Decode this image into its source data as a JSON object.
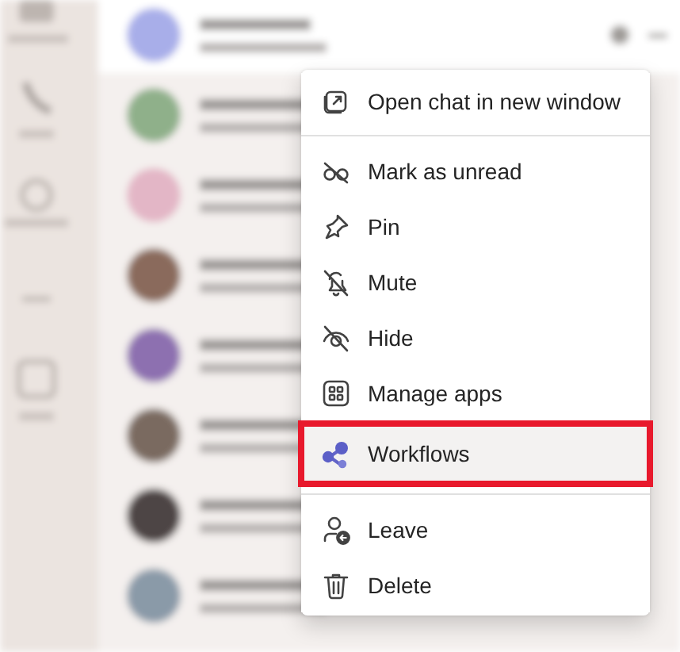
{
  "context_menu": {
    "groups": [
      {
        "items": [
          {
            "label": "Open chat in new window",
            "kind": "popout",
            "highlighted": false
          }
        ]
      },
      {
        "items": [
          {
            "label": "Mark as unread",
            "kind": "unread",
            "highlighted": false
          },
          {
            "label": "Pin",
            "kind": "pin",
            "highlighted": false
          },
          {
            "label": "Mute",
            "kind": "mute",
            "highlighted": false
          },
          {
            "label": "Hide",
            "kind": "hide",
            "highlighted": false
          },
          {
            "label": "Manage apps",
            "kind": "apps",
            "highlighted": false
          },
          {
            "label": "Workflows",
            "kind": "workflows",
            "highlighted": true
          }
        ]
      },
      {
        "items": [
          {
            "label": "Leave",
            "kind": "leave",
            "highlighted": false
          },
          {
            "label": "Delete",
            "kind": "delete",
            "highlighted": false
          }
        ]
      }
    ]
  }
}
